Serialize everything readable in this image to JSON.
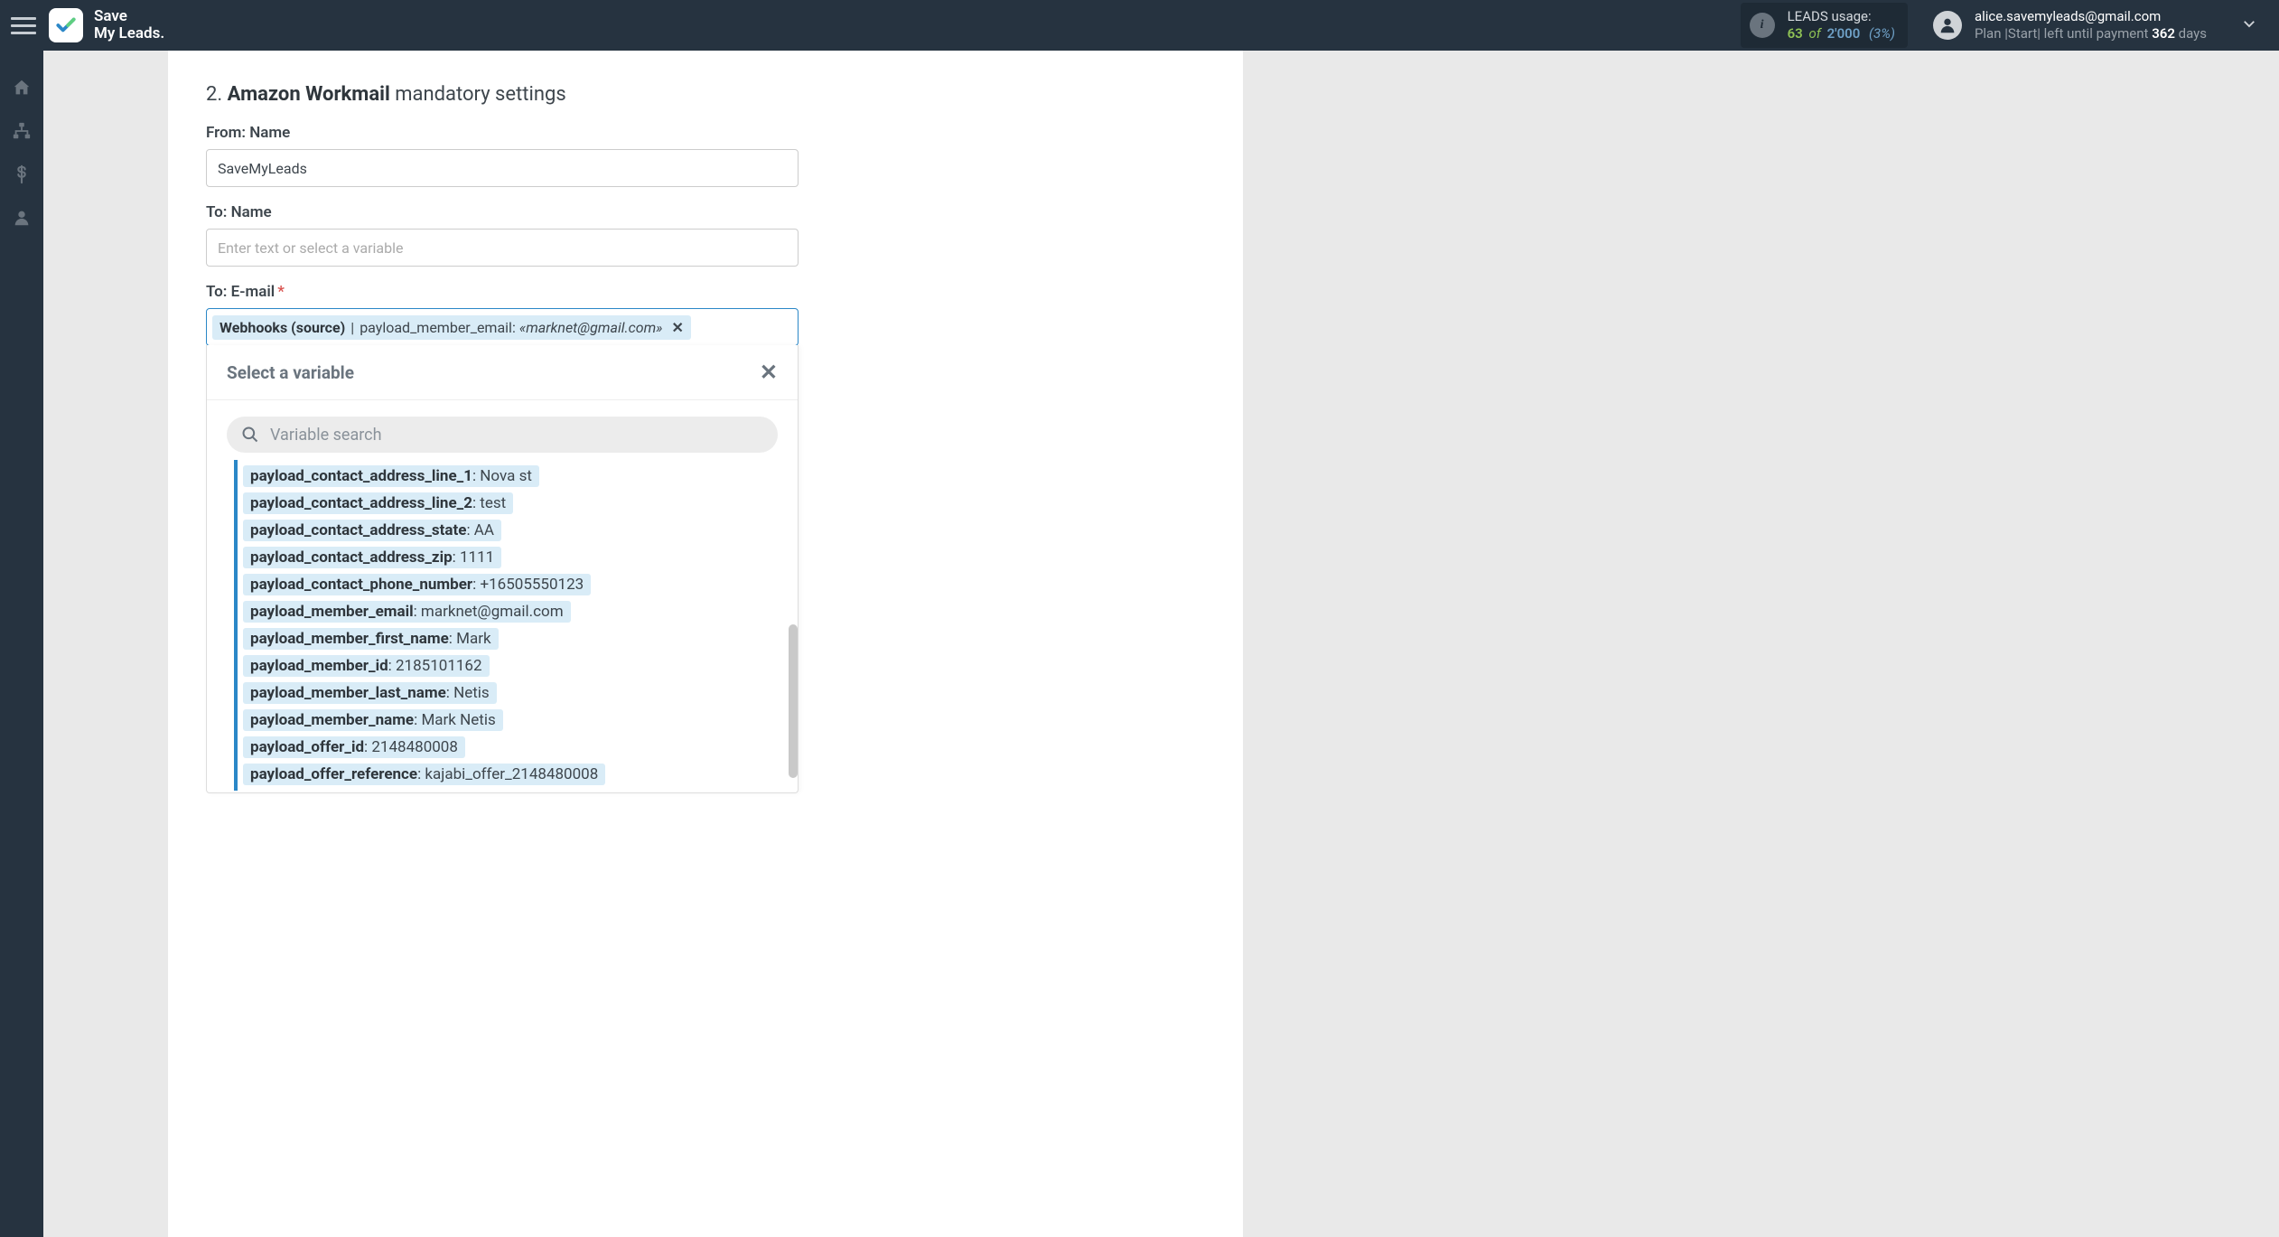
{
  "header": {
    "brand_line1": "Save",
    "brand_line2": "My Leads.",
    "usage_title": "LEADS usage:",
    "usage_current": "63",
    "usage_of": "of",
    "usage_max": "2'000",
    "usage_pct": "(3%)",
    "account_email": "alice.savemyleads@gmail.com",
    "plan_prefix": "Plan",
    "plan_name": "Start",
    "plan_mid": "left until payment",
    "plan_days_num": "362",
    "plan_days_word": "days"
  },
  "section": {
    "num": "2.",
    "service": "Amazon Workmail",
    "mandatory": "mandatory settings"
  },
  "fields": {
    "from_name_label": "From: Name",
    "from_name_value": "SaveMyLeads",
    "to_name_label": "To: Name",
    "to_name_placeholder": "Enter text or select a variable",
    "to_email_label": "To: E-mail",
    "to_email_tag": {
      "source": "Webhooks (source)",
      "key": "payload_member_email:",
      "value": "«marknet@gmail.com»"
    }
  },
  "dropdown": {
    "title": "Select a variable",
    "search_placeholder": "Variable search",
    "items": [
      {
        "name": "payload_contact_address_line_1",
        "value": "Nova st"
      },
      {
        "name": "payload_contact_address_line_2",
        "value": "test"
      },
      {
        "name": "payload_contact_address_state",
        "value": "AA"
      },
      {
        "name": "payload_contact_address_zip",
        "value": "1111"
      },
      {
        "name": "payload_contact_phone_number",
        "value": "+16505550123"
      },
      {
        "name": "payload_member_email",
        "value": "marknet@gmail.com"
      },
      {
        "name": "payload_member_first_name",
        "value": "Mark"
      },
      {
        "name": "payload_member_id",
        "value": "2185101162"
      },
      {
        "name": "payload_member_last_name",
        "value": "Netis"
      },
      {
        "name": "payload_member_name",
        "value": "Mark Netis"
      },
      {
        "name": "payload_offer_id",
        "value": "2148480008"
      },
      {
        "name": "payload_offer_reference",
        "value": "kajabi_offer_2148480008"
      }
    ]
  }
}
